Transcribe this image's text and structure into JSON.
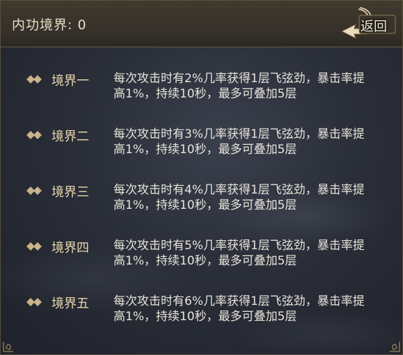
{
  "header": {
    "title": "内功境界: 0",
    "back_label": "返回"
  },
  "levels": [
    {
      "name": "境界一",
      "desc": "每次攻击时有2%几率获得1层飞弦劲，暴击率提高1%，持续10秒，最多可叠加5层"
    },
    {
      "name": "境界二",
      "desc": "每次攻击时有3%几率获得1层飞弦劲，暴击率提高1%，持续10秒，最多可叠加5层"
    },
    {
      "name": "境界三",
      "desc": "每次攻击时有4%几率获得1层飞弦劲，暴击率提高1%，持续10秒，最多可叠加5层"
    },
    {
      "name": "境界四",
      "desc": "每次攻击时有5%几率获得1层飞弦劲，暴击率提高1%，持续10秒，最多可叠加5层"
    },
    {
      "name": "境界五",
      "desc": "每次攻击时有6%几率获得1层飞弦劲，暴击率提高1%，持续10秒，最多可叠加5层"
    }
  ],
  "colors": {
    "accent_gold": "#d9c39a",
    "diamond": "#c9b38a",
    "text": "#e8e4dc"
  },
  "icons": {
    "back": "curved-arrow-icon",
    "bullet": "double-diamond-icon"
  }
}
